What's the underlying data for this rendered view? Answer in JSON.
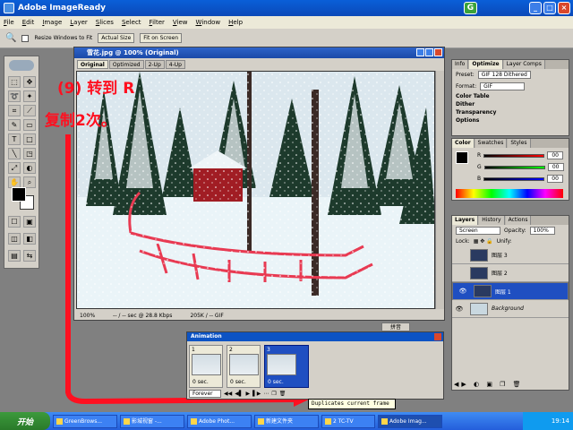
{
  "window": {
    "title": "Adobe ImageReady",
    "minimize": "_",
    "maximize": "□",
    "close": "×"
  },
  "menu": [
    "File",
    "Edit",
    "Image",
    "Layer",
    "Slices",
    "Select",
    "Filter",
    "View",
    "Window",
    "Help"
  ],
  "options": {
    "resize_label": "Resize Windows to Fit",
    "actual_size": "Actual Size",
    "fit_on_screen": "Fit on Screen"
  },
  "doc": {
    "title": "雪花.jpg @ 100% (Original)",
    "tabs": [
      "Original",
      "Optimized",
      "2-Up",
      "4-Up"
    ],
    "zoom": "100%",
    "speed": "-- / -- sec @ 28.8 Kbps",
    "size": "205K / -- GIF"
  },
  "annotation": {
    "line1": "(9) 转到 R",
    "line2": "复制2次。"
  },
  "animation": {
    "title": "Animation",
    "frames": [
      {
        "num": "1",
        "delay": "0 sec."
      },
      {
        "num": "2",
        "delay": "0 sec."
      },
      {
        "num": "3",
        "delay": "0 sec."
      }
    ],
    "loop": "Forever"
  },
  "ime": "拼音",
  "tooltip": "Duplicates current frame",
  "optimize": {
    "tabs": [
      "Info",
      "Optimize",
      "Layer Comps"
    ],
    "preset_label": "Preset:",
    "preset": "GIF 128 Dithered",
    "format_label": "Format:",
    "format": "GIF",
    "sections": [
      "Color Table",
      "Dither",
      "Transparency",
      "Options"
    ]
  },
  "color": {
    "tabs": [
      "Color",
      "Swatches",
      "Styles"
    ],
    "r_label": "R",
    "g_label": "G",
    "b_label": "B",
    "r": "00",
    "g": "00",
    "b": "00"
  },
  "layers": {
    "tabs": [
      "Layers",
      "History",
      "Actions"
    ],
    "blend": "Screen",
    "opacity_label": "Opacity:",
    "opacity": "100%",
    "lock_label": "Lock:",
    "unify_label": "Unify:",
    "items": [
      {
        "name": "图层 3",
        "selected": false
      },
      {
        "name": "图层 2",
        "selected": false
      },
      {
        "name": "图层 1",
        "selected": true
      },
      {
        "name": "Background",
        "selected": false
      }
    ]
  },
  "taskbar": {
    "start": "开始",
    "items": [
      "GreenBrows...",
      "影城视窗 -...",
      "Adobe Phot...",
      "新建文件夹",
      "2 TC-TV",
      "Adobe Imag..."
    ],
    "time": "19:14"
  }
}
